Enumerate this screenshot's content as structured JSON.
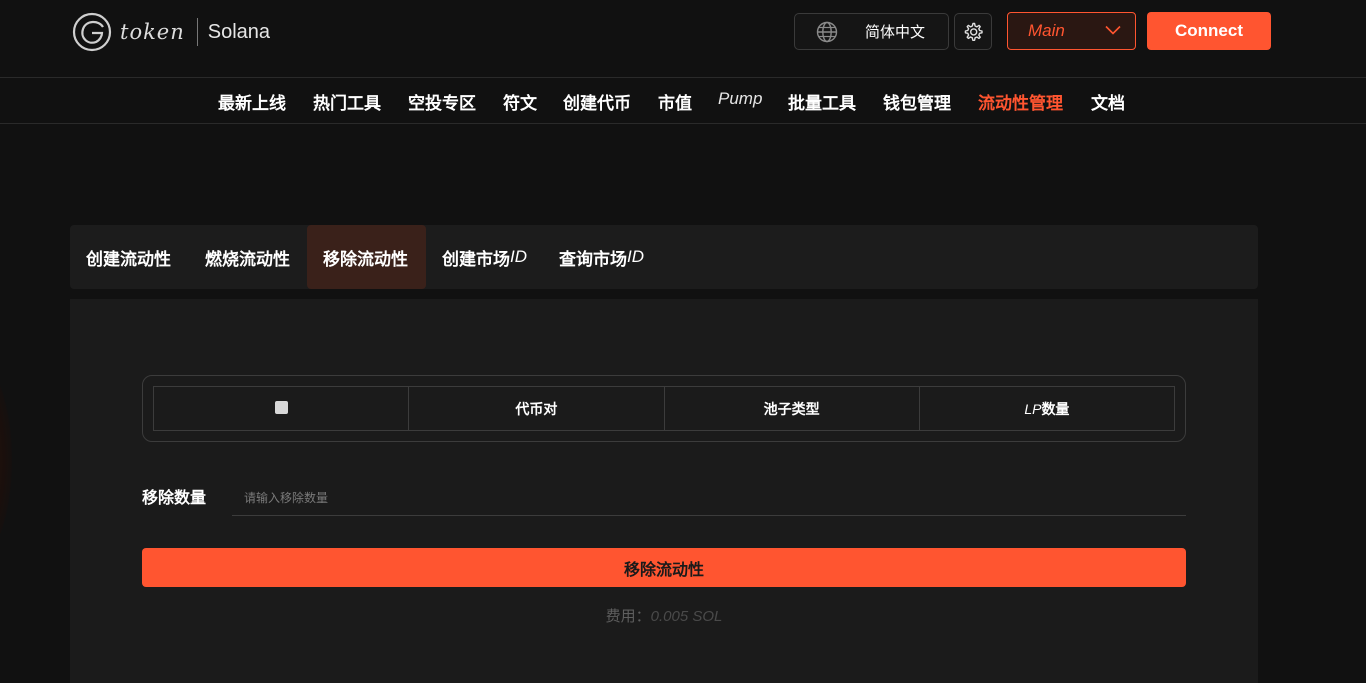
{
  "header": {
    "logo_text": "token",
    "chain": "Solana",
    "language": "简体中文",
    "network": "Main",
    "connect_label": "Connect",
    "icons": {
      "language": "globe-icon",
      "settings": "gear-icon",
      "network": "chevron-down-icon"
    }
  },
  "nav": {
    "items": [
      {
        "label": "最新上线"
      },
      {
        "label": "热门工具"
      },
      {
        "label": "空投专区"
      },
      {
        "label": "符文"
      },
      {
        "label": "创建代币"
      },
      {
        "label": "市值"
      },
      {
        "label": "Pump"
      },
      {
        "label": "批量工具"
      },
      {
        "label": "钱包管理"
      },
      {
        "label": "流动性管理"
      },
      {
        "label": "文档"
      }
    ],
    "active": "流动性管理"
  },
  "tabs": {
    "items": [
      {
        "label": "创建流动性"
      },
      {
        "label": "燃烧流动性"
      },
      {
        "label": "移除流动性"
      },
      {
        "cjk": "创建市场",
        "latin": "ID"
      },
      {
        "cjk": "查询市场",
        "latin": "ID"
      }
    ],
    "active": "移除流动性"
  },
  "table": {
    "columns": [
      {
        "type": "checkbox"
      },
      {
        "label": "代币对"
      },
      {
        "label": "池子类型"
      },
      {
        "latin": "LP",
        "cjk": "数量"
      }
    ]
  },
  "form": {
    "amount_label": "移除数量",
    "amount_placeholder": "请输入移除数量",
    "amount_value": "",
    "submit_label": "移除流动性",
    "fee_label": "费用：",
    "fee_value": "0.005 SOL"
  },
  "colors": {
    "accent": "#ff5530",
    "background": "#111111",
    "panel": "#1b1b1b",
    "active_tab": "#3a211a"
  }
}
